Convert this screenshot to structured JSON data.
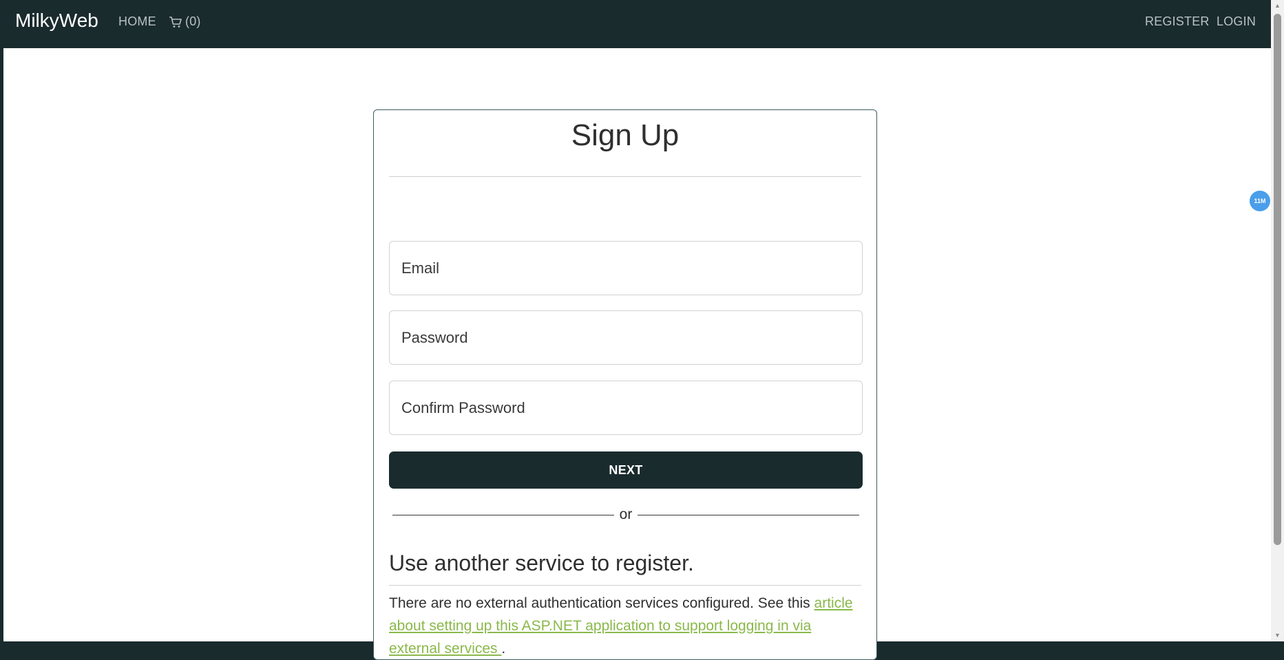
{
  "navbar": {
    "brand": "MilkyWeb",
    "home": "HOME",
    "cart_count": "(0)",
    "register": "REGISTER",
    "login": "LOGIN"
  },
  "form": {
    "title": "Sign Up",
    "email_placeholder": "Email",
    "password_placeholder": "Password",
    "confirm_placeholder": "Confirm Password",
    "next_label": "NEXT",
    "or_label": "or"
  },
  "external": {
    "heading": "Use another service to register.",
    "text_before": "There are no external authentication services configured. See this ",
    "link_text": "article about setting up this ASP.NET application to support logging in via external services ",
    "text_after": "."
  },
  "badge": "11M",
  "colors": {
    "navbar_bg": "#1a2b2e",
    "link_green": "#8ab84a",
    "badge_blue": "#4a9eea"
  },
  "icons": {
    "cart": "cart-icon"
  }
}
